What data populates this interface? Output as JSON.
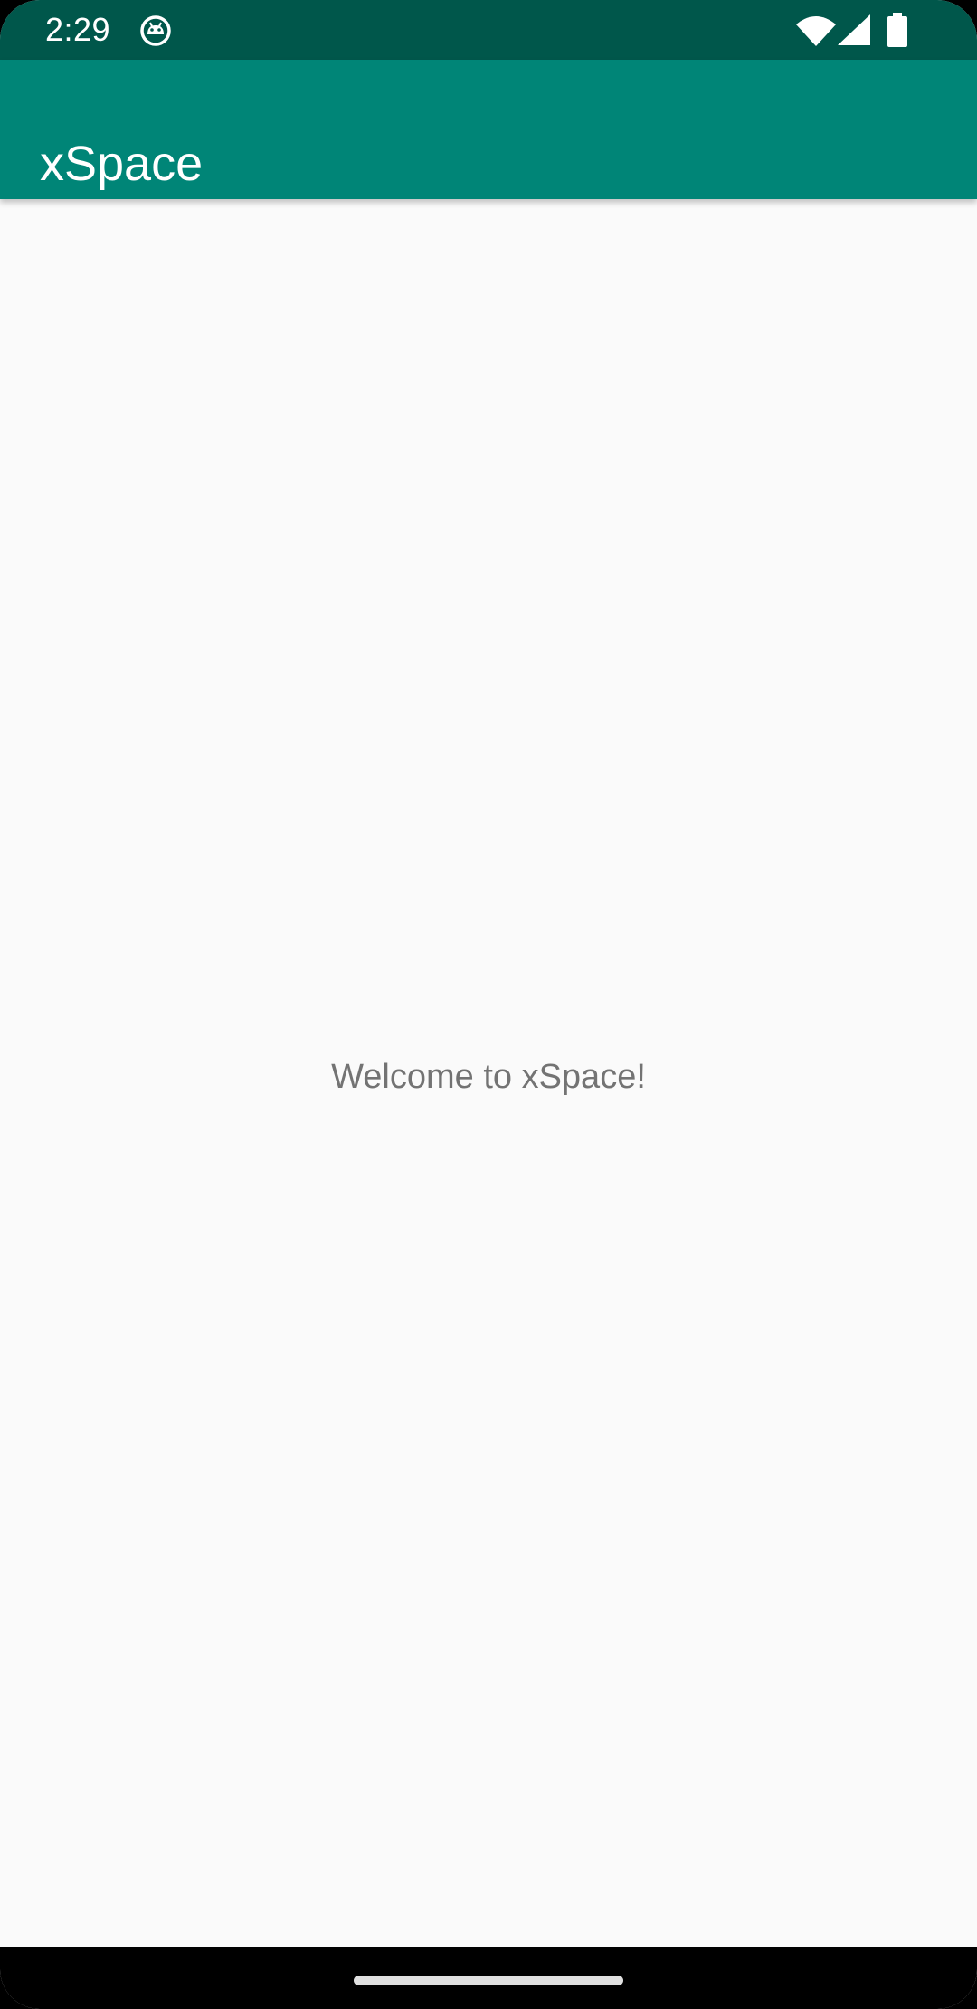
{
  "status_bar": {
    "time": "2:29",
    "notification_icon": "android-debug-icon",
    "wifi_icon": "wifi-icon",
    "signal_icon": "cell-signal-icon",
    "battery_icon": "battery-icon",
    "background_color": "#00574b"
  },
  "app_bar": {
    "title": "xSpace",
    "background_color": "#008577"
  },
  "main": {
    "welcome_text": "Welcome to xSpace!",
    "background_color": "#fafafa"
  },
  "navigation_bar": {
    "home_handle_icon": "home-gesture-handle"
  }
}
